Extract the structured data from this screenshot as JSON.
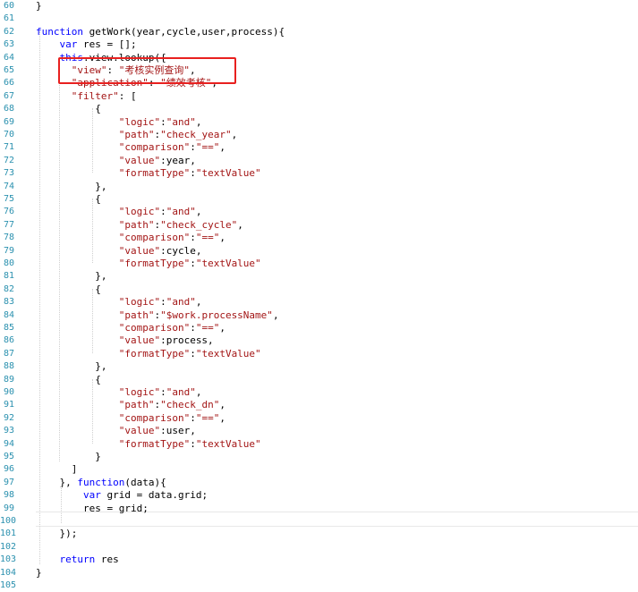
{
  "editor": {
    "line_numbers": [
      "60",
      "61",
      "62",
      "63",
      "64",
      "65",
      "66",
      "67",
      "68",
      "69",
      "70",
      "71",
      "72",
      "73",
      "74",
      "75",
      "76",
      "77",
      "78",
      "79",
      "80",
      "81",
      "82",
      "83",
      "84",
      "85",
      "86",
      "87",
      "88",
      "89",
      "90",
      "91",
      "92",
      "93",
      "94",
      "95",
      "96",
      "97",
      "98",
      "99",
      "100",
      "101",
      "102",
      "103",
      "104",
      "105"
    ],
    "lines": [
      [
        {
          "t": "}",
          "c": "plain"
        }
      ],
      [],
      [
        {
          "t": "function",
          "c": "kw"
        },
        {
          "t": " getWork(year,cycle,user,process){",
          "c": "plain"
        }
      ],
      [
        {
          "t": "    ",
          "c": "plain"
        },
        {
          "t": "var",
          "c": "kw"
        },
        {
          "t": " res = [];",
          "c": "plain"
        }
      ],
      [
        {
          "t": "    ",
          "c": "plain"
        },
        {
          "t": "this",
          "c": "kw"
        },
        {
          "t": ".view.lookup({",
          "c": "plain"
        }
      ],
      [
        {
          "t": "      ",
          "c": "plain"
        },
        {
          "t": "\"view\"",
          "c": "str"
        },
        {
          "t": ": ",
          "c": "plain"
        },
        {
          "t": "\"考核实例查询\"",
          "c": "str"
        },
        {
          "t": ",",
          "c": "plain"
        }
      ],
      [
        {
          "t": "      ",
          "c": "plain"
        },
        {
          "t": "\"application\"",
          "c": "str"
        },
        {
          "t": ": ",
          "c": "plain"
        },
        {
          "t": "\"绩效考核\"",
          "c": "str"
        },
        {
          "t": ",",
          "c": "plain"
        }
      ],
      [
        {
          "t": "      ",
          "c": "plain"
        },
        {
          "t": "\"filter\"",
          "c": "str"
        },
        {
          "t": ": [",
          "c": "plain"
        }
      ],
      [
        {
          "t": "          {",
          "c": "plain"
        }
      ],
      [
        {
          "t": "              ",
          "c": "plain"
        },
        {
          "t": "\"logic\"",
          "c": "str"
        },
        {
          "t": ":",
          "c": "plain"
        },
        {
          "t": "\"and\"",
          "c": "str"
        },
        {
          "t": ",",
          "c": "plain"
        }
      ],
      [
        {
          "t": "              ",
          "c": "plain"
        },
        {
          "t": "\"path\"",
          "c": "str"
        },
        {
          "t": ":",
          "c": "plain"
        },
        {
          "t": "\"check_year\"",
          "c": "str"
        },
        {
          "t": ",",
          "c": "plain"
        }
      ],
      [
        {
          "t": "              ",
          "c": "plain"
        },
        {
          "t": "\"comparison\"",
          "c": "str"
        },
        {
          "t": ":",
          "c": "plain"
        },
        {
          "t": "\"==\"",
          "c": "str"
        },
        {
          "t": ",",
          "c": "plain"
        }
      ],
      [
        {
          "t": "              ",
          "c": "plain"
        },
        {
          "t": "\"value\"",
          "c": "str"
        },
        {
          "t": ":year,",
          "c": "plain"
        }
      ],
      [
        {
          "t": "              ",
          "c": "plain"
        },
        {
          "t": "\"formatType\"",
          "c": "str"
        },
        {
          "t": ":",
          "c": "plain"
        },
        {
          "t": "\"textValue\"",
          "c": "str"
        }
      ],
      [
        {
          "t": "          },",
          "c": "plain"
        }
      ],
      [
        {
          "t": "          {",
          "c": "plain"
        }
      ],
      [
        {
          "t": "              ",
          "c": "plain"
        },
        {
          "t": "\"logic\"",
          "c": "str"
        },
        {
          "t": ":",
          "c": "plain"
        },
        {
          "t": "\"and\"",
          "c": "str"
        },
        {
          "t": ",",
          "c": "plain"
        }
      ],
      [
        {
          "t": "              ",
          "c": "plain"
        },
        {
          "t": "\"path\"",
          "c": "str"
        },
        {
          "t": ":",
          "c": "plain"
        },
        {
          "t": "\"check_cycle\"",
          "c": "str"
        },
        {
          "t": ",",
          "c": "plain"
        }
      ],
      [
        {
          "t": "              ",
          "c": "plain"
        },
        {
          "t": "\"comparison\"",
          "c": "str"
        },
        {
          "t": ":",
          "c": "plain"
        },
        {
          "t": "\"==\"",
          "c": "str"
        },
        {
          "t": ",",
          "c": "plain"
        }
      ],
      [
        {
          "t": "              ",
          "c": "plain"
        },
        {
          "t": "\"value\"",
          "c": "str"
        },
        {
          "t": ":cycle,",
          "c": "plain"
        }
      ],
      [
        {
          "t": "              ",
          "c": "plain"
        },
        {
          "t": "\"formatType\"",
          "c": "str"
        },
        {
          "t": ":",
          "c": "plain"
        },
        {
          "t": "\"textValue\"",
          "c": "str"
        }
      ],
      [
        {
          "t": "          },",
          "c": "plain"
        }
      ],
      [
        {
          "t": "          {",
          "c": "plain"
        }
      ],
      [
        {
          "t": "              ",
          "c": "plain"
        },
        {
          "t": "\"logic\"",
          "c": "str"
        },
        {
          "t": ":",
          "c": "plain"
        },
        {
          "t": "\"and\"",
          "c": "str"
        },
        {
          "t": ",",
          "c": "plain"
        }
      ],
      [
        {
          "t": "              ",
          "c": "plain"
        },
        {
          "t": "\"path\"",
          "c": "str"
        },
        {
          "t": ":",
          "c": "plain"
        },
        {
          "t": "\"$work.processName\"",
          "c": "str"
        },
        {
          "t": ",",
          "c": "plain"
        }
      ],
      [
        {
          "t": "              ",
          "c": "plain"
        },
        {
          "t": "\"comparison\"",
          "c": "str"
        },
        {
          "t": ":",
          "c": "plain"
        },
        {
          "t": "\"==\"",
          "c": "str"
        },
        {
          "t": ",",
          "c": "plain"
        }
      ],
      [
        {
          "t": "              ",
          "c": "plain"
        },
        {
          "t": "\"value\"",
          "c": "str"
        },
        {
          "t": ":process,",
          "c": "plain"
        }
      ],
      [
        {
          "t": "              ",
          "c": "plain"
        },
        {
          "t": "\"formatType\"",
          "c": "str"
        },
        {
          "t": ":",
          "c": "plain"
        },
        {
          "t": "\"textValue\"",
          "c": "str"
        }
      ],
      [
        {
          "t": "          },",
          "c": "plain"
        }
      ],
      [
        {
          "t": "          {",
          "c": "plain"
        }
      ],
      [
        {
          "t": "              ",
          "c": "plain"
        },
        {
          "t": "\"logic\"",
          "c": "str"
        },
        {
          "t": ":",
          "c": "plain"
        },
        {
          "t": "\"and\"",
          "c": "str"
        },
        {
          "t": ",",
          "c": "plain"
        }
      ],
      [
        {
          "t": "              ",
          "c": "plain"
        },
        {
          "t": "\"path\"",
          "c": "str"
        },
        {
          "t": ":",
          "c": "plain"
        },
        {
          "t": "\"check_dn\"",
          "c": "str"
        },
        {
          "t": ",",
          "c": "plain"
        }
      ],
      [
        {
          "t": "              ",
          "c": "plain"
        },
        {
          "t": "\"comparison\"",
          "c": "str"
        },
        {
          "t": ":",
          "c": "plain"
        },
        {
          "t": "\"==\"",
          "c": "str"
        },
        {
          "t": ",",
          "c": "plain"
        }
      ],
      [
        {
          "t": "              ",
          "c": "plain"
        },
        {
          "t": "\"value\"",
          "c": "str"
        },
        {
          "t": ":user,",
          "c": "plain"
        }
      ],
      [
        {
          "t": "              ",
          "c": "plain"
        },
        {
          "t": "\"formatType\"",
          "c": "str"
        },
        {
          "t": ":",
          "c": "plain"
        },
        {
          "t": "\"textValue\"",
          "c": "str"
        }
      ],
      [
        {
          "t": "          }",
          "c": "plain"
        }
      ],
      [
        {
          "t": "      ]",
          "c": "plain"
        }
      ],
      [
        {
          "t": "    }, ",
          "c": "plain"
        },
        {
          "t": "function",
          "c": "kw"
        },
        {
          "t": "(data){",
          "c": "plain"
        }
      ],
      [
        {
          "t": "        ",
          "c": "plain"
        },
        {
          "t": "var",
          "c": "kw"
        },
        {
          "t": " grid = data.grid;",
          "c": "plain"
        }
      ],
      [
        {
          "t": "        res = grid;",
          "c": "plain"
        }
      ],
      [],
      [
        {
          "t": "    });",
          "c": "plain"
        }
      ],
      [],
      [
        {
          "t": "    ",
          "c": "plain"
        },
        {
          "t": "return",
          "c": "kw"
        },
        {
          "t": " res",
          "c": "plain"
        }
      ],
      [
        {
          "t": "}",
          "c": "plain"
        }
      ],
      []
    ]
  }
}
